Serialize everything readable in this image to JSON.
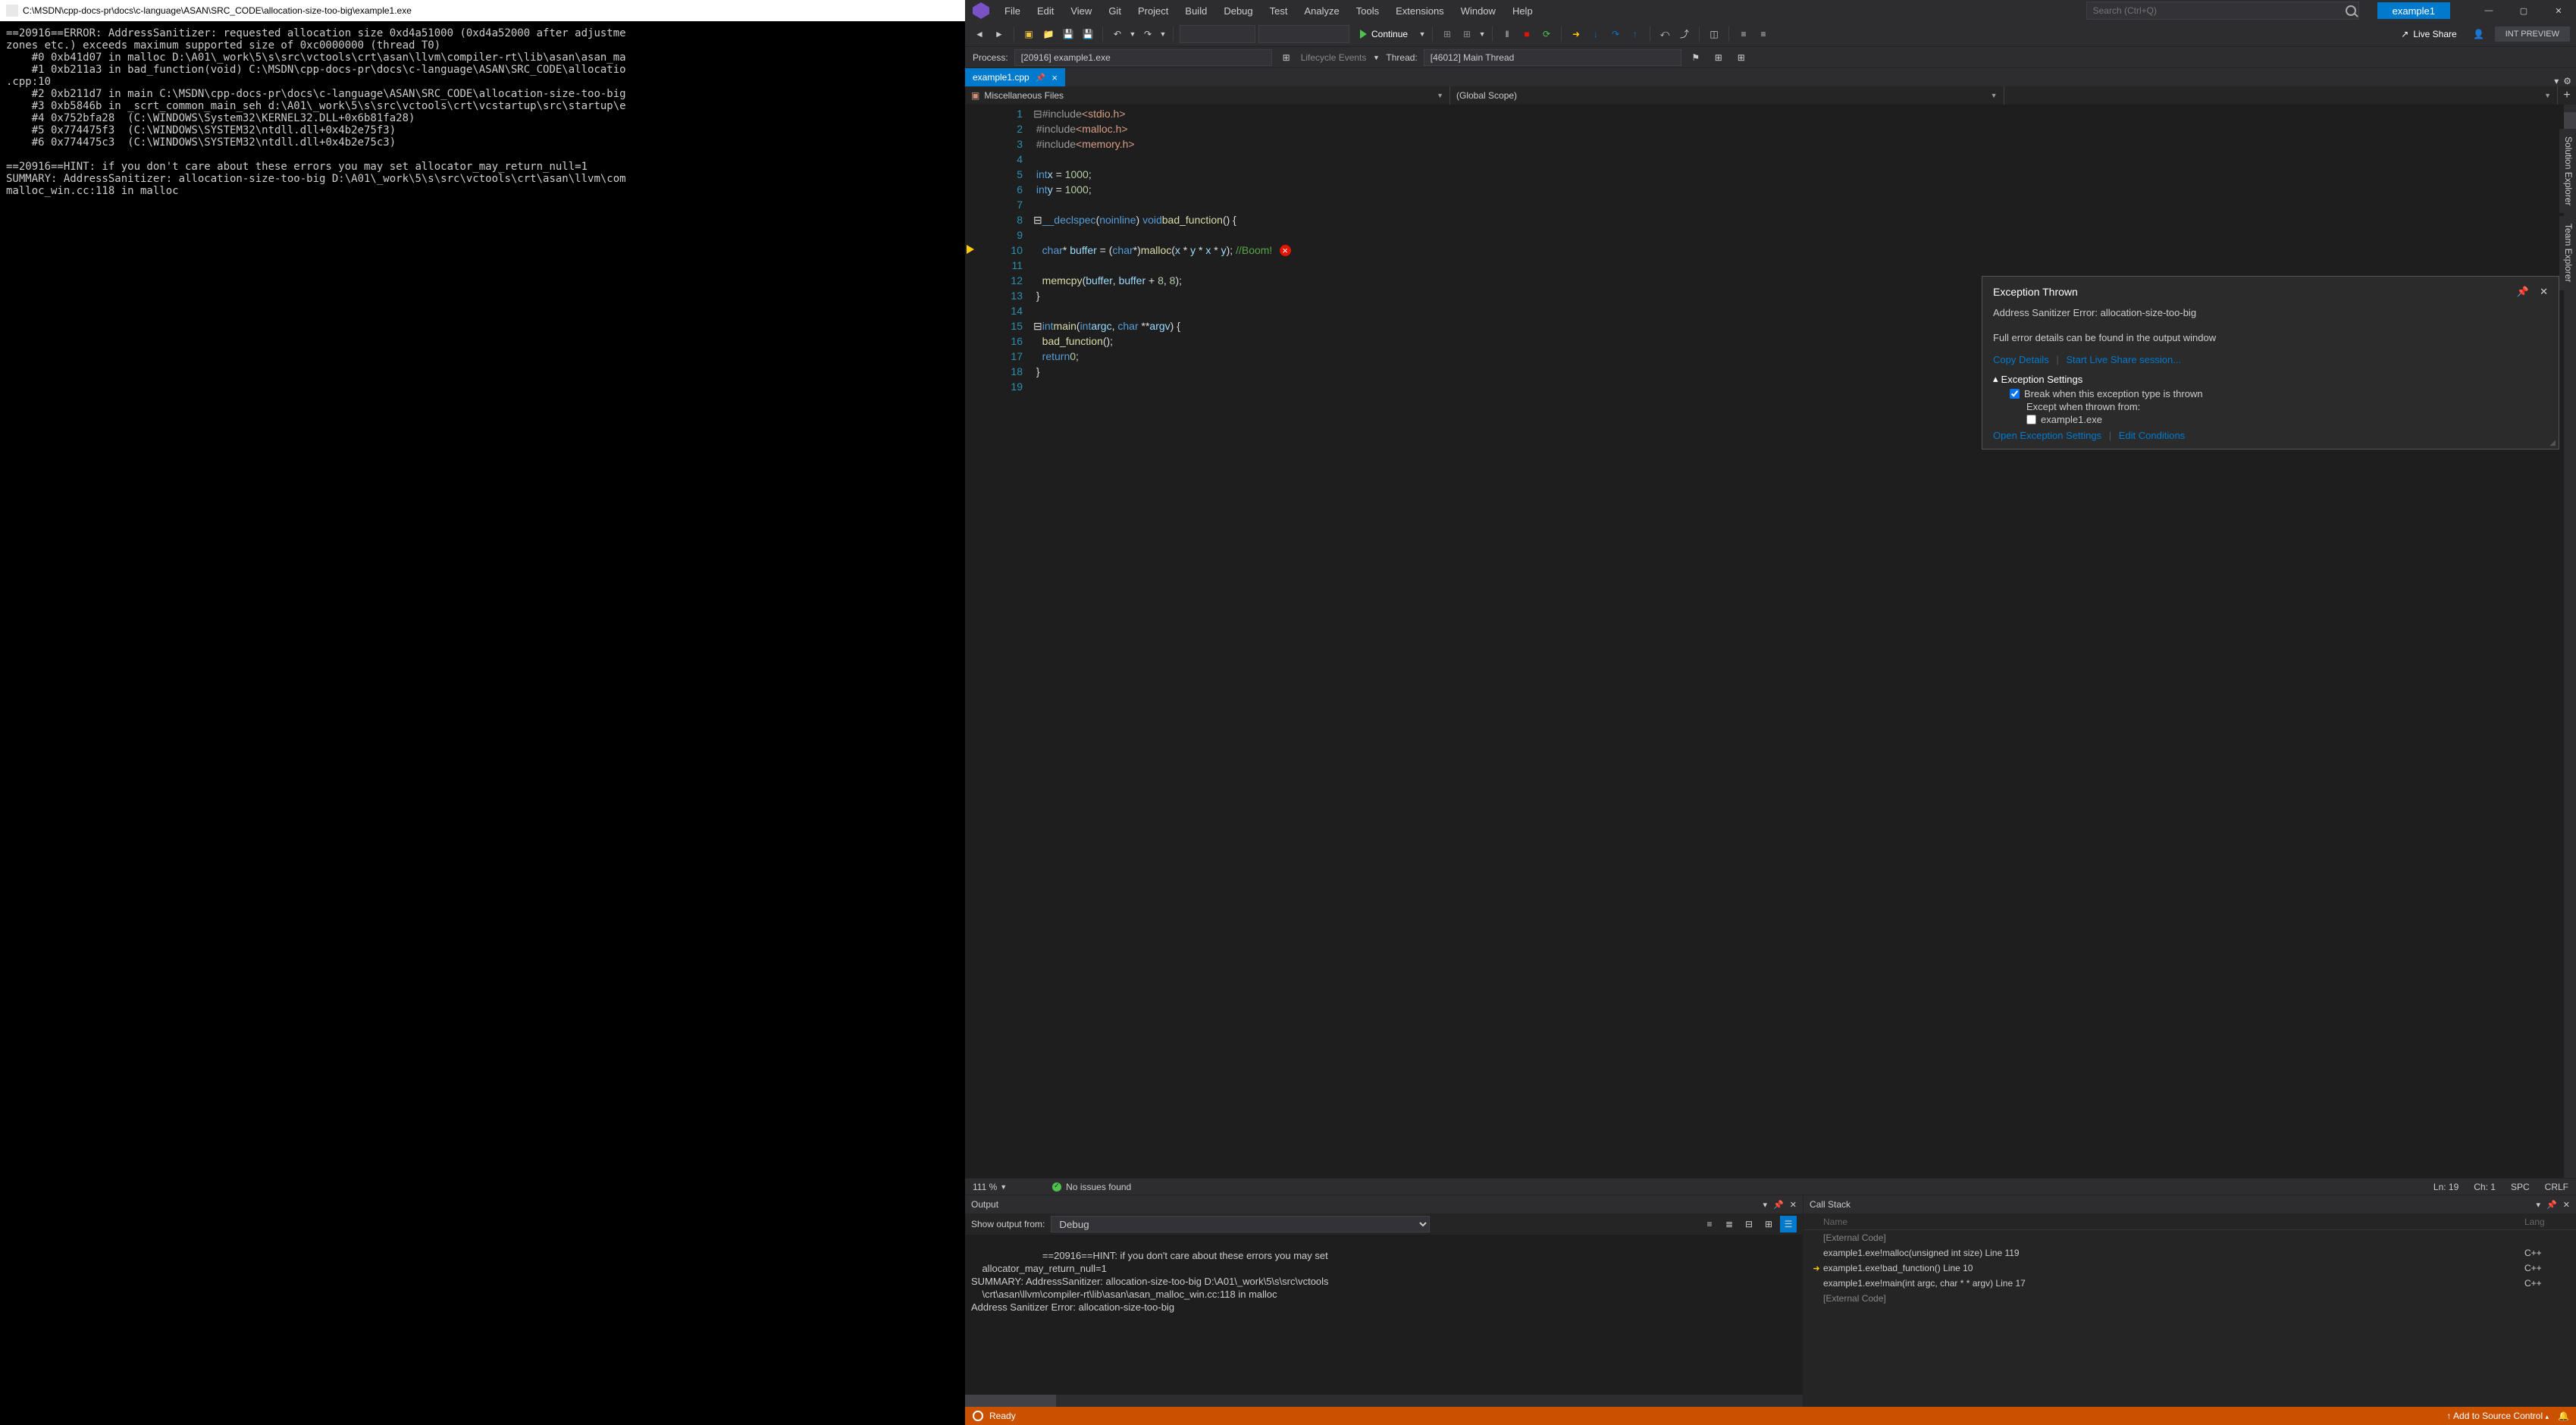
{
  "console": {
    "title": "C:\\MSDN\\cpp-docs-pr\\docs\\c-language\\ASAN\\SRC_CODE\\allocation-size-too-big\\example1.exe",
    "body": "==20916==ERROR: AddressSanitizer: requested allocation size 0xd4a51000 (0xd4a52000 after adjustme\nzones etc.) exceeds maximum supported size of 0xc0000000 (thread T0)\n    #0 0xb41d07 in malloc D:\\A01\\_work\\5\\s\\src\\vctools\\crt\\asan\\llvm\\compiler-rt\\lib\\asan\\asan_ma\n    #1 0xb211a3 in bad_function(void) C:\\MSDN\\cpp-docs-pr\\docs\\c-language\\ASAN\\SRC_CODE\\allocatio\n.cpp:10\n    #2 0xb211d7 in main C:\\MSDN\\cpp-docs-pr\\docs\\c-language\\ASAN\\SRC_CODE\\allocation-size-too-big\n    #3 0xb5846b in _scrt_common_main_seh d:\\A01\\_work\\5\\s\\src\\vctools\\crt\\vcstartup\\src\\startup\\e\n    #4 0x752bfa28  (C:\\WINDOWS\\System32\\KERNEL32.DLL+0x6b81fa28)\n    #5 0x774475f3  (C:\\WINDOWS\\SYSTEM32\\ntdll.dll+0x4b2e75f3)\n    #6 0x774475c3  (C:\\WINDOWS\\SYSTEM32\\ntdll.dll+0x4b2e75c3)\n\n==20916==HINT: if you don't care about these errors you may set allocator_may_return_null=1\nSUMMARY: AddressSanitizer: allocation-size-too-big D:\\A01\\_work\\5\\s\\src\\vctools\\crt\\asan\\llvm\\com\nmalloc_win.cc:118 in malloc"
  },
  "vs": {
    "menus": [
      "File",
      "Edit",
      "View",
      "Git",
      "Project",
      "Build",
      "Debug",
      "Test",
      "Analyze",
      "Tools",
      "Extensions",
      "Window",
      "Help"
    ],
    "search_placeholder": "Search (Ctrl+Q)",
    "solution_name": "example1",
    "toolbar": {
      "continue": "Continue",
      "liveshare": "Live Share",
      "intpreview": "INT PREVIEW"
    },
    "process": {
      "label_process": "Process:",
      "process_value": "[20916] example1.exe",
      "lifecycle": "Lifecycle Events",
      "label_thread": "Thread:",
      "thread_value": "[46012] Main Thread"
    },
    "right_tabs": [
      "Solution Explorer",
      "Team Explorer"
    ]
  },
  "editor": {
    "tab": {
      "name": "example1.cpp"
    },
    "nav": {
      "l": "Miscellaneous Files",
      "m": "(Global Scope)",
      "r": ""
    },
    "lines": [
      {
        "n": 1,
        "html": "<span class='c-pre'>⊟#include</span> <span class='c-str'>&lt;stdio.h&gt;</span>"
      },
      {
        "n": 2,
        "html": "<span class='c-pre'>&nbsp;#include</span> <span class='c-str'>&lt;malloc.h&gt;</span>"
      },
      {
        "n": 3,
        "html": "<span class='c-pre'>&nbsp;#include</span> <span class='c-str'>&lt;memory.h&gt;</span>"
      },
      {
        "n": 4,
        "html": ""
      },
      {
        "n": 5,
        "html": "&nbsp;<span class='c-typ'>int</span> <span class='c-id'>x</span> = <span class='c-num'>1000</span>;"
      },
      {
        "n": 6,
        "html": "&nbsp;<span class='c-typ'>int</span> <span class='c-id'>y</span> = <span class='c-num'>1000</span>;"
      },
      {
        "n": 7,
        "html": ""
      },
      {
        "n": 8,
        "html": "⊟<span class='c-typ'>__declspec</span>(<span class='c-typ'>noinline</span>) <span class='c-typ'>void</span> <span class='c-fn'>bad_function</span>() {"
      },
      {
        "n": 9,
        "html": "&nbsp;"
      },
      {
        "n": 10,
        "html": "&nbsp;&nbsp;&nbsp;<span class='c-typ'>char</span>* <span class='c-id'>buffer</span> = (<span class='c-typ'>char</span>*)<span class='c-fn'>malloc</span>(<span class='c-id'>x</span> * <span class='c-id'>y</span> * <span class='c-id'>x</span> * <span class='c-id'>y</span>); <span class='c-cmt'>//Boom!</span><span class='error-dot' data-name='error-icon' data-interactable='true'></span>",
        "current": true
      },
      {
        "n": 11,
        "html": ""
      },
      {
        "n": 12,
        "html": "&nbsp;&nbsp;&nbsp;<span class='c-fn'>memcpy</span>(<span class='c-id'>buffer</span>, <span class='c-id'>buffer</span> + <span class='c-num'>8</span>, <span class='c-num'>8</span>);"
      },
      {
        "n": 13,
        "html": "&nbsp;}"
      },
      {
        "n": 14,
        "html": ""
      },
      {
        "n": 15,
        "html": "⊟<span class='c-typ'>int</span> <span class='c-fn'>main</span>(<span class='c-typ'>int</span> <span class='c-id'>argc</span>, <span class='c-typ'>char</span> **<span class='c-id'>argv</span>) {"
      },
      {
        "n": 16,
        "html": "&nbsp;&nbsp;&nbsp;<span class='c-fn'>bad_function</span>();"
      },
      {
        "n": 17,
        "html": "&nbsp;&nbsp;&nbsp;<span class='c-kw'>return</span> <span class='c-num'>0</span>;"
      },
      {
        "n": 18,
        "html": "&nbsp;}"
      },
      {
        "n": 19,
        "html": ""
      }
    ],
    "status": {
      "zoom": "111 %",
      "issues": "No issues found",
      "ln": "Ln: 19",
      "ch": "Ch: 1",
      "spc": "SPC",
      "crlf": "CRLF"
    }
  },
  "exception": {
    "title": "Exception Thrown",
    "msg": "Address Sanitizer Error: allocation-size-too-big",
    "sub": "Full error details can be found in the output window",
    "link_copy": "Copy Details",
    "link_liveshare": "Start Live Share session...",
    "settings_hdr": "Exception Settings",
    "break_label": "Break when this exception type is thrown",
    "except_label": "Except when thrown from:",
    "except_item": "example1.exe",
    "link_open": "Open Exception Settings",
    "link_edit": "Edit Conditions"
  },
  "output": {
    "title": "Output",
    "show_label": "Show output from:",
    "show_value": "Debug",
    "body": "==20916==HINT: if you don't care about these errors you may set\n    allocator_may_return_null=1\nSUMMARY: AddressSanitizer: allocation-size-too-big D:\\A01\\_work\\5\\s\\src\\vctools\n    \\crt\\asan\\llvm\\compiler-rt\\lib\\asan\\asan_malloc_win.cc:118 in malloc\nAddress Sanitizer Error: allocation-size-too-big"
  },
  "callstack": {
    "title": "Call Stack",
    "col_name": "Name",
    "col_lang": "Lang",
    "rows": [
      {
        "dim": true,
        "name": "[External Code]",
        "lang": ""
      },
      {
        "dim": false,
        "name": "example1.exe!malloc(unsigned int size) Line 119",
        "lang": "C++"
      },
      {
        "dim": false,
        "name": "example1.exe!bad_function() Line 10",
        "lang": "C++",
        "current": true
      },
      {
        "dim": false,
        "name": "example1.exe!main(int argc, char * * argv) Line 17",
        "lang": "C++"
      },
      {
        "dim": true,
        "name": "[External Code]",
        "lang": ""
      }
    ]
  },
  "statusbar": {
    "ready": "Ready",
    "add_source": "Add to Source Control"
  }
}
